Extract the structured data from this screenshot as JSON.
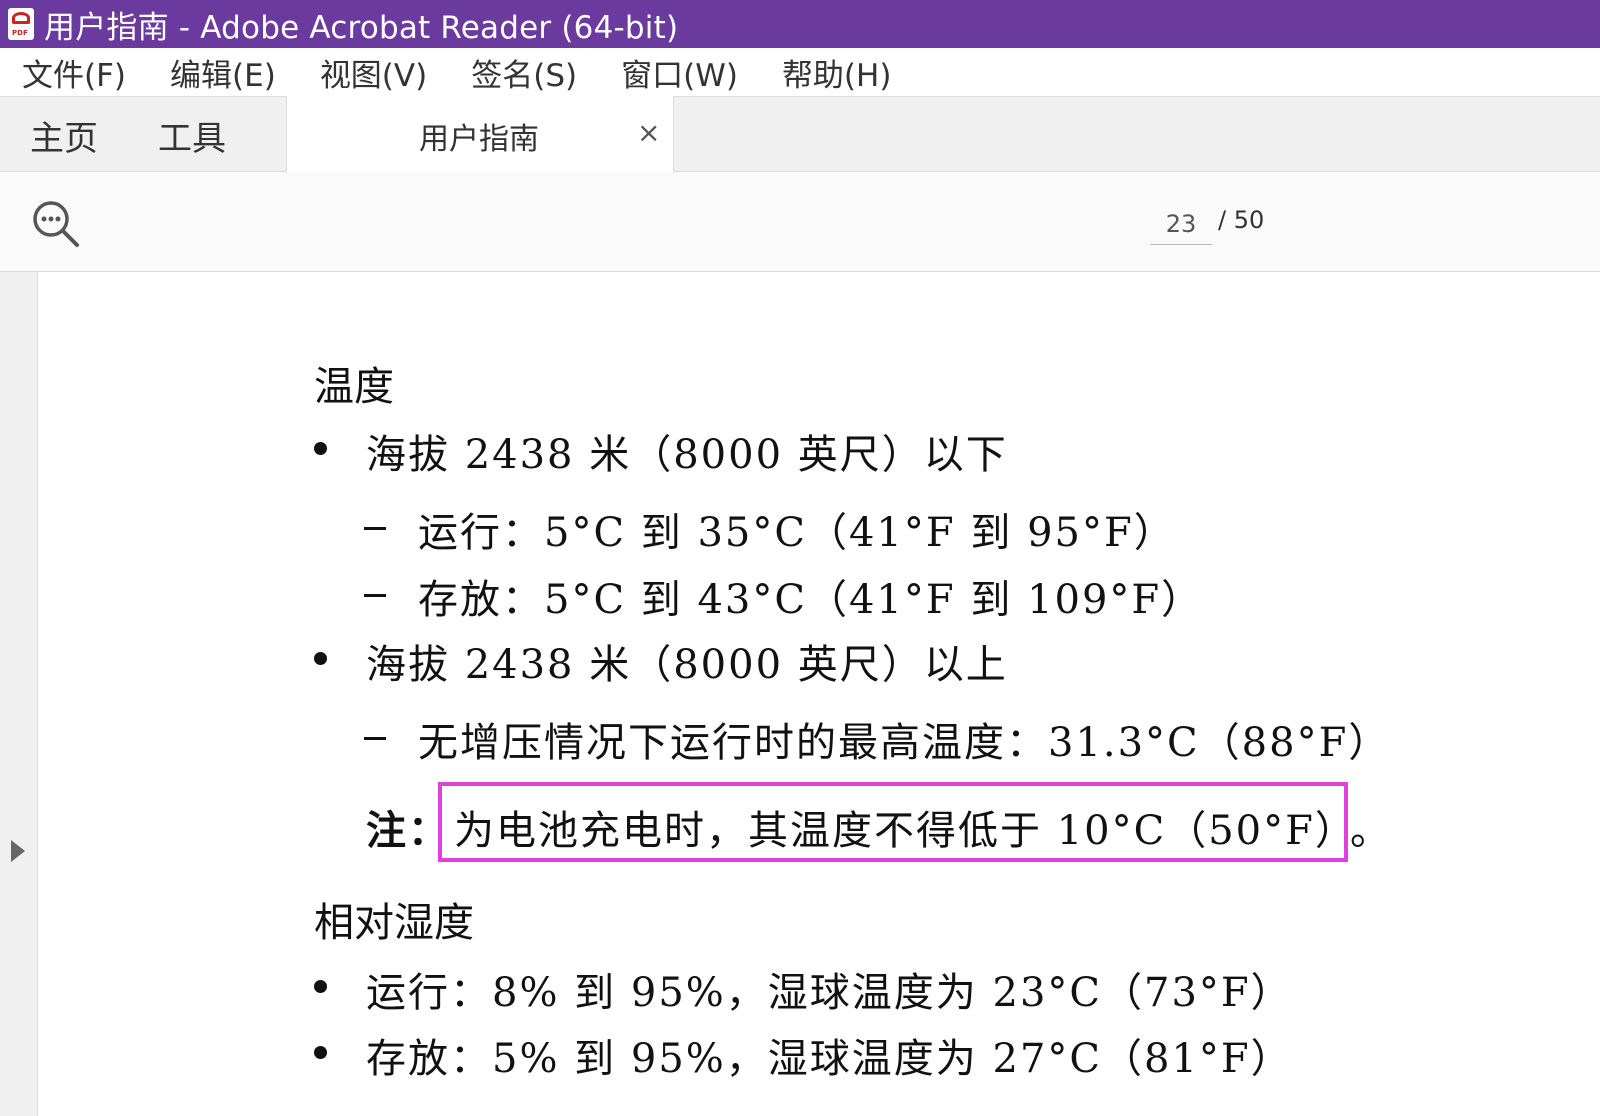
{
  "window": {
    "title": "用户指南 - Adobe Acrobat Reader (64-bit)",
    "app_icon": "pdf-icon",
    "app_icon_label": "PDF"
  },
  "menubar": {
    "items": [
      "文件(F)",
      "编辑(E)",
      "视图(V)",
      "签名(S)",
      "窗口(W)",
      "帮助(H)"
    ]
  },
  "tabs": {
    "home": "主页",
    "tools": "工具",
    "document": "用户指南",
    "close": "×"
  },
  "toolbar": {
    "current_page": "23",
    "total_pages": "/ 50"
  },
  "content": {
    "heading_temperature": "温度",
    "bullet1": "海拔 2438 米（8000 英尺）以下",
    "sub1": "运行：5°C 到 35°C（41°F 到 95°F）",
    "sub2": "存放：5°C 到 43°C（41°F 到 109°F）",
    "bullet2": "海拔 2438 米（8000 英尺）以上",
    "sub3": "无增压情况下运行时的最高温度：31.3°C（88°F）",
    "note_label": "注：",
    "note_text": "为电池充电时，其温度不得低于 10°C（50°F）",
    "note_end": "。",
    "heading_humidity": "相对湿度",
    "bullet3": "运行：8% 到 95%，湿球温度为 23°C（73°F）",
    "bullet4": "存放：5% 到 95%，湿球温度为 27°C（81°F）"
  },
  "colors": {
    "titlebar": "#6a3a9e",
    "highlight": "#e040e0"
  }
}
